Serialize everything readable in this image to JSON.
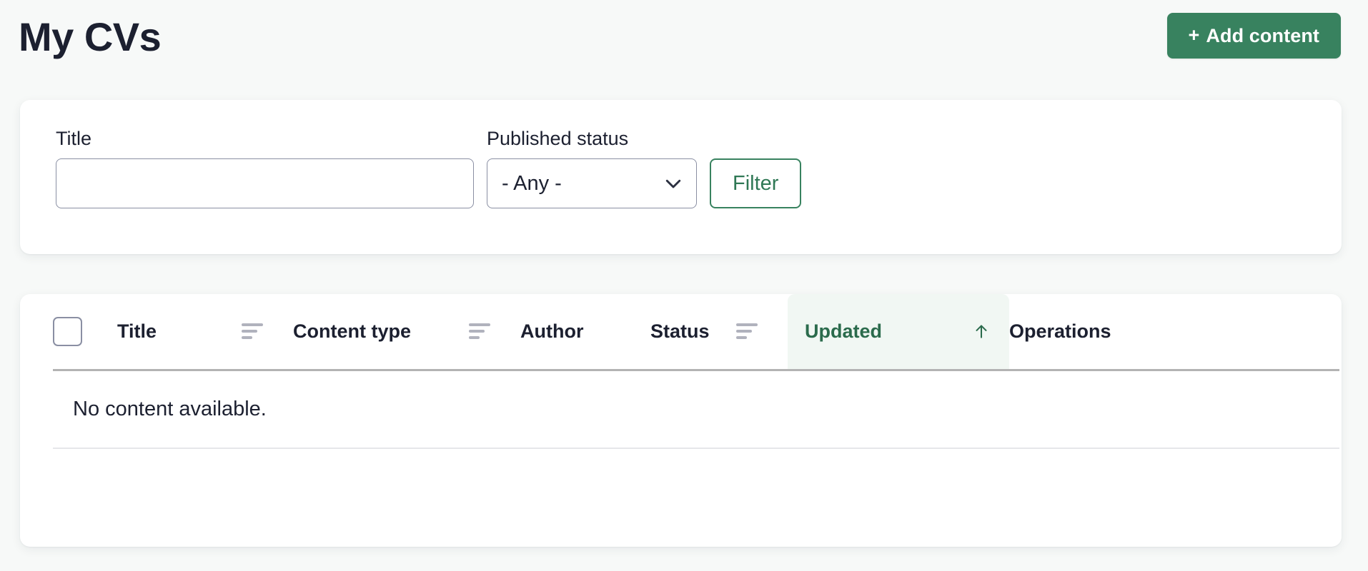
{
  "page": {
    "title": "My CVs",
    "background_color": "#f7f9f8",
    "accent_color": "#38825f"
  },
  "header": {
    "title": "My CVs",
    "add_content_button": {
      "label": "Add content",
      "plus_glyph": "+",
      "icon": "plus-icon",
      "background_color": "#38825f",
      "text_color": "#ffffff"
    }
  },
  "filters": {
    "title_field": {
      "label": "Title",
      "value": "",
      "placeholder": ""
    },
    "published_status_field": {
      "label": "Published status",
      "selected": "- Any -",
      "options": [
        "- Any -"
      ],
      "icon": "chevron-down-icon"
    },
    "filter_button": {
      "label": "Filter",
      "border_color": "#38825f",
      "text_color": "#2f7855"
    }
  },
  "table": {
    "select_all": {
      "icon": "checkbox-icon",
      "checked": false
    },
    "columns": [
      {
        "key": "select",
        "label": "",
        "sortable": false
      },
      {
        "key": "title",
        "label": "Title",
        "sortable": true,
        "sort_icon": "sort-icon"
      },
      {
        "key": "content_type",
        "label": "Content type",
        "sortable": true,
        "sort_icon": "sort-icon"
      },
      {
        "key": "author",
        "label": "Author",
        "sortable": false
      },
      {
        "key": "status",
        "label": "Status",
        "sortable": true,
        "sort_icon": "sort-icon"
      },
      {
        "key": "updated",
        "label": "Updated",
        "sortable": true,
        "active": true,
        "sort_direction": "asc",
        "sort_icon": "sort-arrow-up-icon"
      },
      {
        "key": "operations",
        "label": "Operations",
        "sortable": false
      }
    ],
    "headers": {
      "title": "Title",
      "content_type": "Content type",
      "author": "Author",
      "status": "Status",
      "updated": "Updated",
      "operations": "Operations"
    },
    "sort": {
      "active_column": "Updated",
      "direction": "asc",
      "arrow_glyph": "↑",
      "active_background": "#f1f7f3",
      "active_text_color": "#2b6b4c"
    },
    "rows": [],
    "empty_message": "No content available."
  }
}
